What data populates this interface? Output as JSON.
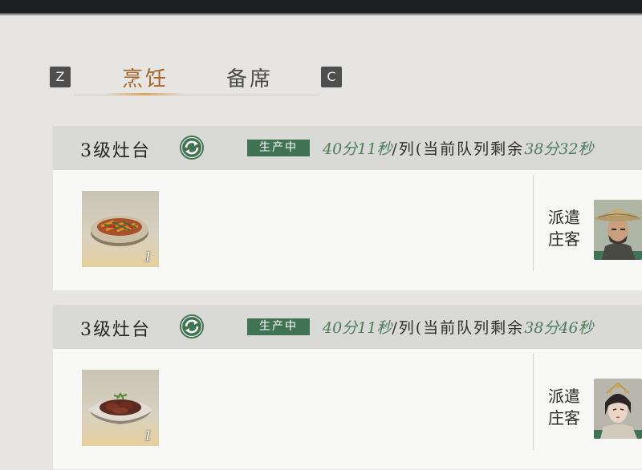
{
  "tabs": {
    "left_key": "Z",
    "right_key": "C",
    "active": "烹饪",
    "other": "备席"
  },
  "cards": [
    {
      "level": "3级灶台",
      "status": "生产中",
      "time_per_queue": "40分11秒",
      "per_queue_label": "/列(当前队列剩余",
      "remaining": "38分32秒",
      "dish_count": "1",
      "dispatch_label": "派遣庄客"
    },
    {
      "level": "3级灶台",
      "status": "生产中",
      "time_per_queue": "40分11秒",
      "per_queue_label": "/列(当前队列剩余",
      "remaining": "38分46秒",
      "dish_count": "1",
      "dispatch_label": "派遣庄客"
    }
  ],
  "colors": {
    "accent_tab": "#a5652b",
    "status_green": "#3f7353",
    "timer_green": "#4e7d5e"
  }
}
